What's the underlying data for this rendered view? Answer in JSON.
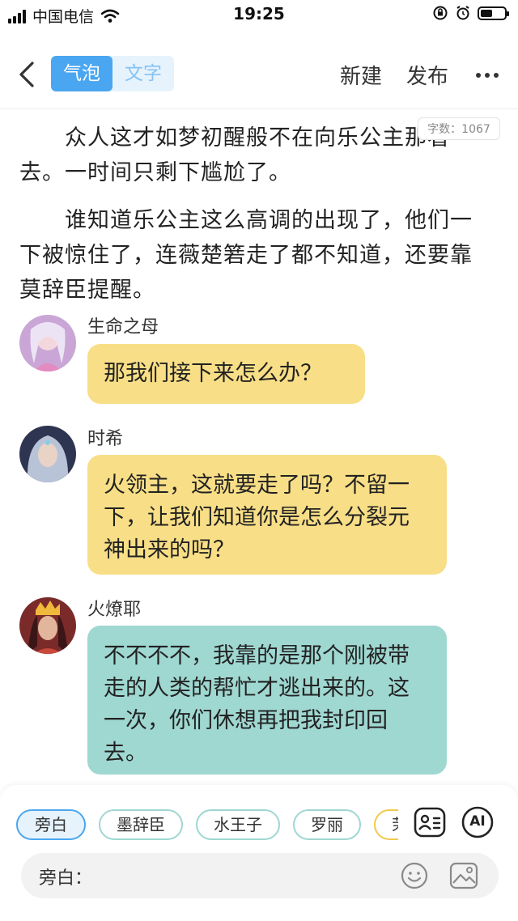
{
  "status": {
    "carrier": "中国电信",
    "time": "19:25"
  },
  "nav": {
    "tab_bubble": "气泡",
    "tab_text": "文字",
    "new_label": "新建",
    "publish_label": "发布"
  },
  "word_count": "字数：1067",
  "paragraphs": [
    "众人这才如梦初醒般不在向乐公主那看去。一时间只剩下尴尬了。",
    "谁知道乐公主这么高调的出现了，他们一下被惊住了，连薇楚箬走了都不知道，还要靠莫辞臣提醒。"
  ],
  "messages": [
    {
      "name": "生命之母",
      "text": "那我们接下来怎么办？",
      "color": "#f8de86"
    },
    {
      "name": "时希",
      "text": "火领主，这就要走了吗？不留一下，让我们知道你是怎么分裂元神出来的吗？",
      "color": "#f8de86"
    },
    {
      "name": "火燎耶",
      "text": "不不不不，我靠的是那个刚被带走的人类的帮忙才逃出来的。这一次，你们休想再把我封印回去。",
      "color": "#9fd7d1"
    }
  ],
  "characters": [
    "旁白",
    "墨辞臣",
    "水王子",
    "罗丽",
    "茉莉"
  ],
  "input": {
    "label": "旁白："
  },
  "ai_label": "AI",
  "icons": [
    "back-arrow-icon",
    "more-icon",
    "character-card-icon",
    "ai-icon",
    "emoji-icon",
    "image-icon"
  ],
  "colors": {
    "accent": "#4aa6f0",
    "yellow_bubble": "#f8de86",
    "teal_bubble": "#9fd7d1"
  }
}
